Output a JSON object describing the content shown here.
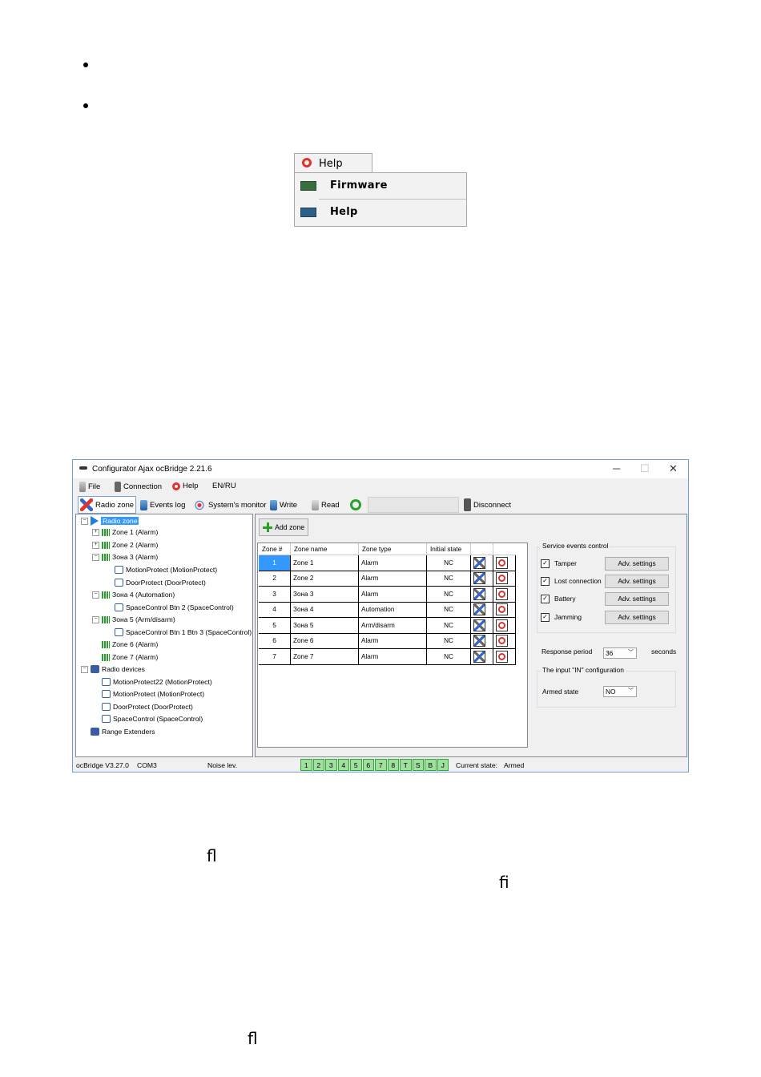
{
  "help_menu": {
    "tab_label": "Help",
    "items": [
      {
        "label": "Firmware",
        "icon": "firmware-icon"
      },
      {
        "label": "Help",
        "icon": "help-info-icon"
      }
    ]
  },
  "ligatures": [
    "ﬂ",
    "ﬁ",
    "ﬂ"
  ],
  "window": {
    "title": "Configurator Ajax ocBridge 2.21.6",
    "controls": {
      "minimize": "─",
      "maximize": "☐",
      "close": "✕"
    },
    "menu": [
      {
        "label": "File",
        "icon": "file-icon"
      },
      {
        "label": "Connection",
        "icon": "connection-icon"
      },
      {
        "label": "Help",
        "icon": "help-lifebuoy-icon"
      },
      {
        "label": "EN/RU",
        "icon": ""
      }
    ],
    "toolbar": {
      "radio_zone": "Radio zone",
      "events_log": "Events log",
      "systems_monitor": "System's monitor",
      "write": "Write",
      "read": "Read",
      "disconnect": "Disconnect"
    },
    "tree": {
      "root": "Radio zone",
      "zones": [
        {
          "label": "Zone 1 (Alarm)"
        },
        {
          "label": "Zone 2 (Alarm)"
        },
        {
          "label": "Зона 3 (Alarm)",
          "children": [
            "MotionProtect (MotionProtect)",
            "DoorProtect (DoorProtect)"
          ]
        },
        {
          "label": "Зона 4 (Automation)",
          "children": [
            "SpaceControl Btn 2 (SpaceControl)"
          ]
        },
        {
          "label": "Зона 5 (Arm/disarm)",
          "children": [
            "SpaceControl Btn 1 Btn 3 (SpaceControl)"
          ]
        },
        {
          "label": "Zone 6 (Alarm)"
        },
        {
          "label": "Zone 7 (Alarm)"
        }
      ],
      "radio_devices_label": "Radio devices",
      "radio_devices": [
        "MotionProtect22 (MotionProtect)",
        "MotionProtect (MotionProtect)",
        "DoorProtect (DoorProtect)",
        "SpaceControl (SpaceControl)"
      ],
      "range_extenders": "Range Extenders"
    },
    "add_zone": "Add zone",
    "table": {
      "headers": [
        "Zone #",
        "Zone name",
        "Zone type",
        "Initial state"
      ],
      "rows": [
        [
          "1",
          "Zone 1",
          "Alarm",
          "NC"
        ],
        [
          "2",
          "Zone 2",
          "Alarm",
          "NC"
        ],
        [
          "3",
          "Зона 3",
          "Alarm",
          "NC"
        ],
        [
          "4",
          "Зона 4",
          "Automation",
          "NC"
        ],
        [
          "5",
          "Зона 5",
          "Arm/disarm",
          "NC"
        ],
        [
          "6",
          "Zone 6",
          "Alarm",
          "NC"
        ],
        [
          "7",
          "Zone 7",
          "Alarm",
          "NC"
        ]
      ]
    },
    "service_events": {
      "title": "Service events control",
      "items": [
        {
          "label": "Tamper",
          "checked": true,
          "button": "Adv. settings"
        },
        {
          "label": "Lost connection",
          "checked": true,
          "button": "Adv. settings"
        },
        {
          "label": "Battery",
          "checked": true,
          "button": "Adv. settings"
        },
        {
          "label": "Jamming",
          "checked": true,
          "button": "Adv. settings"
        }
      ]
    },
    "response_period": {
      "label": "Response period",
      "value": "36",
      "unit": "seconds"
    },
    "input_config": {
      "title": "The input \"IN\" configuration",
      "label": "Armed state",
      "value": "NO"
    },
    "status": {
      "version": "ocBridge V3.27.0",
      "port": "COM3",
      "noise": "Noise lev.",
      "cells": [
        "1",
        "2",
        "3",
        "4",
        "5",
        "6",
        "7",
        "8",
        "T",
        "S",
        "B",
        "J"
      ],
      "current_state_label": "Current state:",
      "current_state": "Armed"
    }
  }
}
